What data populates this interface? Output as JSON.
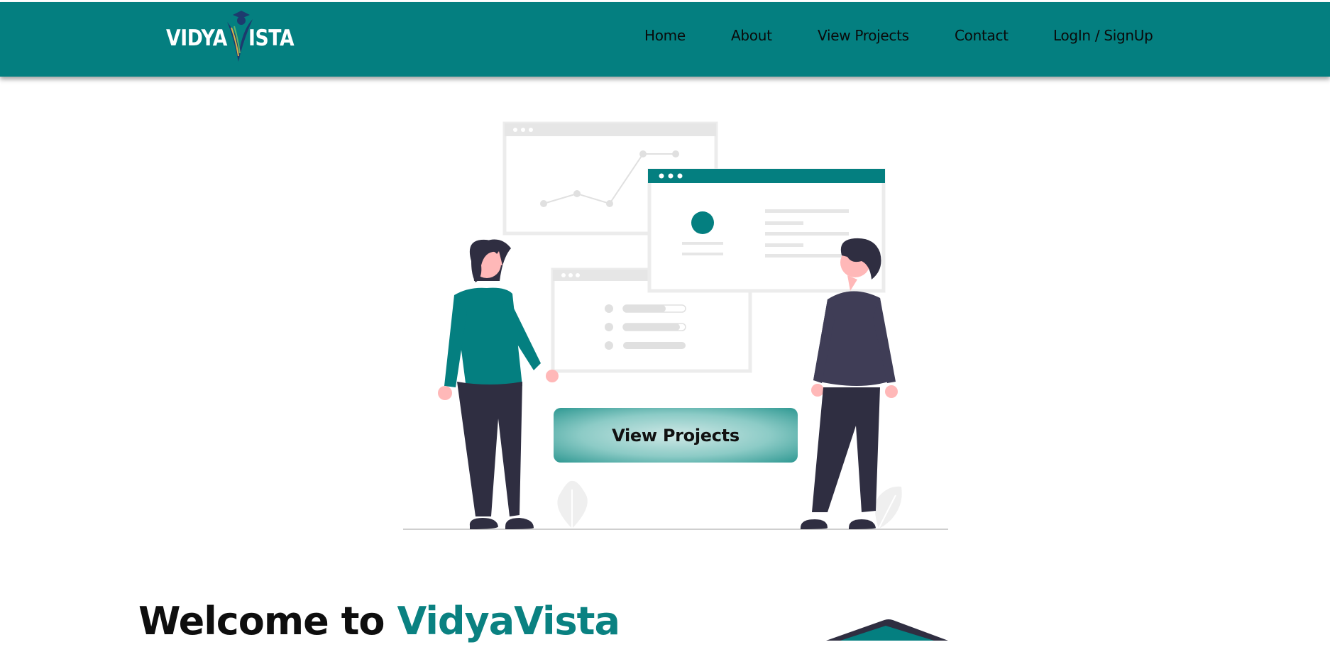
{
  "header": {
    "logo": {
      "left_text": "VIDYA",
      "right_text": "ISTA"
    },
    "nav": [
      {
        "label": "Home"
      },
      {
        "label": "About"
      },
      {
        "label": "View Projects"
      },
      {
        "label": "Contact"
      },
      {
        "label": "LogIn / SignUp"
      }
    ]
  },
  "hero": {
    "cta_label": "View Projects"
  },
  "welcome": {
    "prefix": "Welcome to",
    "brand": "VidyaVista"
  },
  "colors": {
    "primary": "#047f80",
    "accent_text": "#0a8181",
    "figure_dark": "#2f2e41",
    "skin": "#ffb8b8"
  }
}
